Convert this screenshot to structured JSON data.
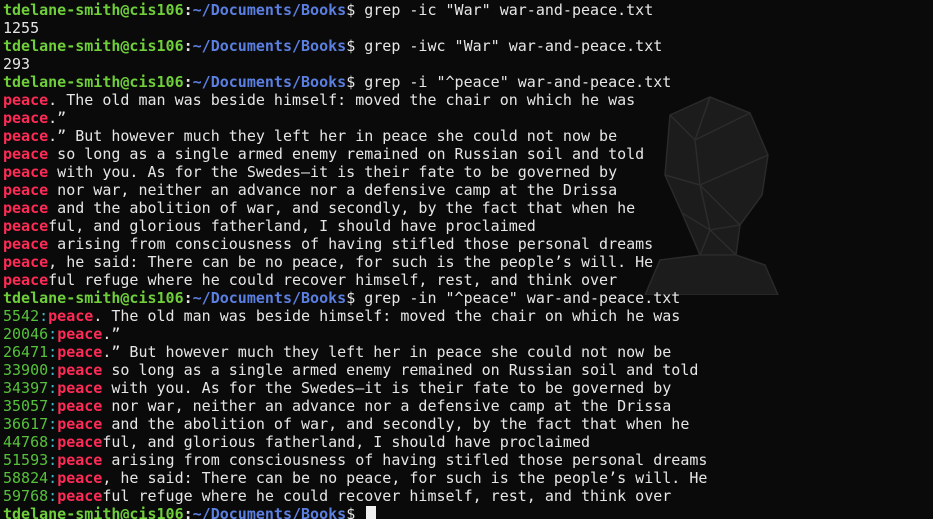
{
  "prompt": {
    "user_host": "tdelane-smith@cis106",
    "separator": ":",
    "path": "~/Documents/Books",
    "symbol": "$"
  },
  "blocks": [
    {
      "command": " grep -ic \"War\" war-and-peace.txt",
      "output": [
        {
          "text": "1255"
        }
      ]
    },
    {
      "command": " grep -iwc \"War\" war-and-peace.txt",
      "output": [
        {
          "text": "293"
        }
      ]
    },
    {
      "command": " grep -i \"^peace\" war-and-peace.txt",
      "matches": [
        {
          "match": "peace",
          "rest": ". The old man was beside himself: moved the chair on which he was"
        },
        {
          "match": "peace",
          "rest": ".”"
        },
        {
          "match": "peace",
          "rest": ".” But however much they left her in peace she could not now be"
        },
        {
          "match": "peace",
          "rest": " so long as a single armed enemy remained on Russian soil and told"
        },
        {
          "match": "peace",
          "rest": " with you. As for the Swedes—it is their fate to be governed by"
        },
        {
          "match": "peace",
          "rest": " nor war, neither an advance nor a defensive camp at the Drissa"
        },
        {
          "match": "peace",
          "rest": " and the abolition of war, and secondly, by the fact that when he"
        },
        {
          "match": "peace",
          "rest": "ful, and glorious fatherland, I should have proclaimed"
        },
        {
          "match": "peace",
          "rest": " arising from consciousness of having stifled those personal dreams"
        },
        {
          "match": "peace",
          "rest": ", he said: There can be no peace, for such is the people’s will. He"
        },
        {
          "match": "peace",
          "rest": "ful refuge where he could recover himself, rest, and think over"
        }
      ]
    },
    {
      "command": " grep -in \"^peace\" war-and-peace.txt",
      "matches": [
        {
          "lnum": "5542",
          "sep": ":",
          "match": "peace",
          "rest": ". The old man was beside himself: moved the chair on which he was"
        },
        {
          "lnum": "20046",
          "sep": ":",
          "match": "peace",
          "rest": ".”"
        },
        {
          "lnum": "26471",
          "sep": ":",
          "match": "peace",
          "rest": ".” But however much they left her in peace she could not now be"
        },
        {
          "lnum": "33900",
          "sep": ":",
          "match": "peace",
          "rest": " so long as a single armed enemy remained on Russian soil and told"
        },
        {
          "lnum": "34397",
          "sep": ":",
          "match": "peace",
          "rest": " with you. As for the Swedes—it is their fate to be governed by"
        },
        {
          "lnum": "35057",
          "sep": ":",
          "match": "peace",
          "rest": " nor war, neither an advance nor a defensive camp at the Drissa"
        },
        {
          "lnum": "36617",
          "sep": ":",
          "match": "peace",
          "rest": " and the abolition of war, and secondly, by the fact that when he"
        },
        {
          "lnum": "44768",
          "sep": ":",
          "match": "peace",
          "rest": "ful, and glorious fatherland, I should have proclaimed"
        },
        {
          "lnum": "51593",
          "sep": ":",
          "match": "peace",
          "rest": " arising from consciousness of having stifled those personal dreams"
        },
        {
          "lnum": "58824",
          "sep": ":",
          "match": "peace",
          "rest": ", he said: There can be no peace, for such is the people’s will. He"
        },
        {
          "lnum": "59768",
          "sep": ":",
          "match": "peace",
          "rest": "ful refuge where he could recover himself, rest, and think over"
        }
      ]
    }
  ],
  "current_command": " ",
  "colors": {
    "background": "#0a0a0a",
    "user_host": "#6fcf3b",
    "path": "#5b7fe0",
    "match": "#ff2a55",
    "line_number": "#56c23a",
    "line_sep": "#3fb9c9",
    "text": "#e6e6e6"
  },
  "watermark_icon": "polygonal-head-icon"
}
